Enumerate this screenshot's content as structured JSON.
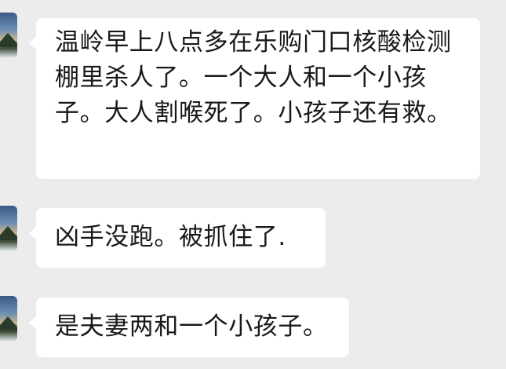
{
  "chat": {
    "messages": [
      {
        "sender_avatar": "avatar-landscape",
        "text": "温岭早上八点多在乐购门口核酸检测棚里杀人了。一个大人和一个小孩子。大人割喉死了。小孩子还有救。"
      },
      {
        "sender_avatar": "avatar-landscape",
        "text": "凶手没跑。被抓住了."
      },
      {
        "sender_avatar": "avatar-landscape",
        "text": "是夫妻两和一个小孩子。"
      }
    ]
  },
  "colors": {
    "background": "#ececec",
    "bubble": "#ffffff",
    "text": "#191919"
  }
}
